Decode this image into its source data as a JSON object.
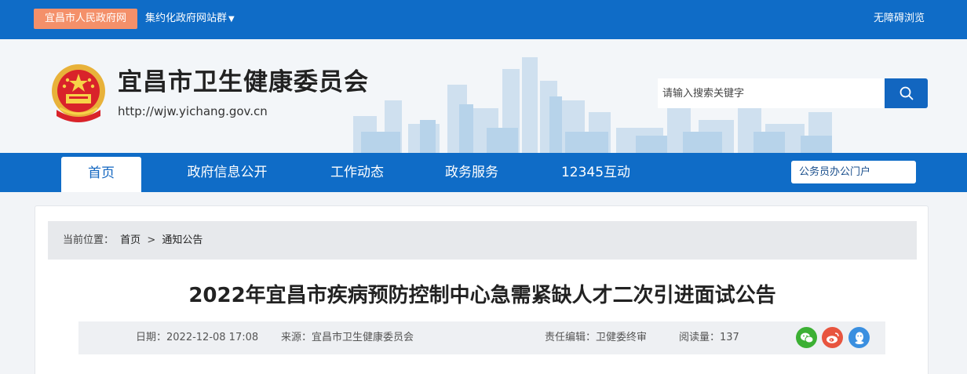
{
  "topbar": {
    "gov_site": "宜昌市人民政府网",
    "site_group": "集约化政府网站群",
    "accessibility": "无障碍浏览"
  },
  "header": {
    "title": "宜昌市卫生健康委员会",
    "url": "http://wjw.yichang.gov.cn",
    "search_placeholder": "请输入搜索关键字"
  },
  "nav": {
    "items": [
      "首页",
      "政府信息公开",
      "工作动态",
      "政务服务",
      "12345互动"
    ],
    "active": "首页",
    "portal": "公务员办公门户"
  },
  "breadcrumb": {
    "label": "当前位置：",
    "home": "首页",
    "sep": ">",
    "current": "通知公告"
  },
  "article": {
    "title": "2022年宜昌市疾病预防控制中心急需紧缺人才二次引进面试公告",
    "date_label": "日期：2022-12-08 17:08",
    "source_label": "来源：宜昌市卫生健康委员会",
    "editor_label": "责任编辑：卫健委终审",
    "views_label": "阅读量：137"
  },
  "share": {
    "icons": [
      "wechat-icon",
      "weibo-icon",
      "qq-icon"
    ],
    "colors": {
      "wechat": "#3cb034",
      "weibo": "#e8553f",
      "qq": "#3a8fe0"
    }
  },
  "colors": {
    "primary": "#0f6cc7",
    "accent_orange": "#f4906a"
  }
}
